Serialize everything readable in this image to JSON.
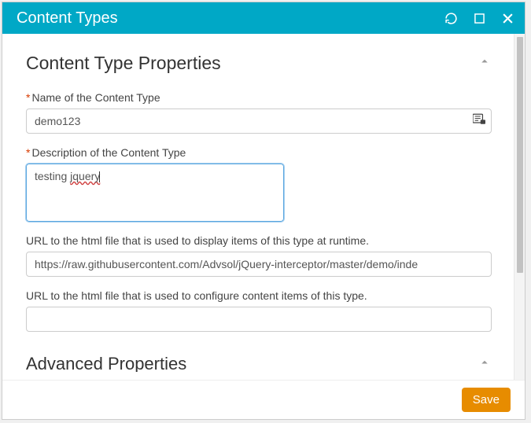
{
  "titlebar": {
    "title": "Content Types"
  },
  "section": {
    "title": "Content Type Properties",
    "advanced_title": "Advanced Properties"
  },
  "fields": {
    "name": {
      "label": "Name of the Content Type",
      "value": "demo123"
    },
    "description": {
      "label": "Description of the Content Type",
      "value_prefix": "testing ",
      "value_spellerr": "jquery"
    },
    "display_url": {
      "label": "URL to the html file that is used to display items of this type at runtime.",
      "value": "https://raw.githubusercontent.com/Advsol/jQuery-interceptor/master/demo/inde"
    },
    "config_url": {
      "label": "URL to the html file that is used to configure content items of this type.",
      "value": ""
    }
  },
  "footer": {
    "save_label": "Save"
  }
}
